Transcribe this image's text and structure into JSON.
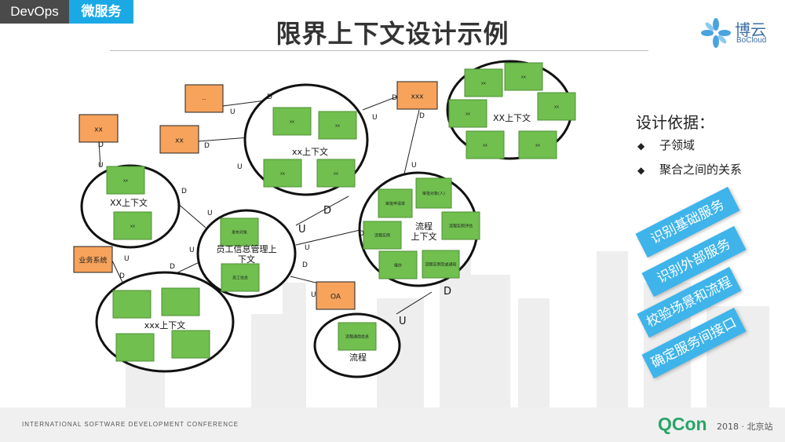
{
  "header": {
    "tag_left": "DevOps",
    "tag_right": "微服务",
    "title": "限界上下文设计示例"
  },
  "logo": {
    "name_cn": "博云",
    "name_en": "BoCloud"
  },
  "design_basis": {
    "title": "设计依据：",
    "items": [
      "子领域",
      "聚合之间的关系"
    ]
  },
  "ribbons": [
    "识别基础服务",
    "识别外部服务",
    "校验场景和流程",
    "确定服务间接口"
  ],
  "footer": {
    "conference": "INTERNATIONAL SOFTWARE DEVELOPMENT CONFERENCE",
    "brand": "QCon",
    "year_city": "2018 · 北京站"
  },
  "diagram": {
    "contexts": [
      {
        "id": "c_xx_top",
        "label": "xx上下文"
      },
      {
        "id": "c_xx_right",
        "label": "XX上下文"
      },
      {
        "id": "c_xx_left",
        "label": "XX上下文"
      },
      {
        "id": "c_employee",
        "label": "员工信息管理上下文"
      },
      {
        "id": "c_flow_ctx",
        "label": "流程上下文"
      },
      {
        "id": "c_xxx",
        "label": "xxx上下文"
      },
      {
        "id": "c_flow",
        "label": "流程"
      }
    ],
    "external_systems": [
      {
        "id": "e_small",
        "label": "··"
      },
      {
        "id": "e_xx1",
        "label": "xx"
      },
      {
        "id": "e_xx2",
        "label": "xx"
      },
      {
        "id": "e_xxx",
        "label": "xxx"
      },
      {
        "id": "e_biz",
        "label": "业务系统"
      },
      {
        "id": "e_oa",
        "label": "OA"
      }
    ],
    "aggregates": [
      {
        "ctx": "c_xx_top",
        "label": "xx"
      },
      {
        "ctx": "c_xx_top",
        "label": "xx"
      },
      {
        "ctx": "c_xx_top",
        "label": "xx"
      },
      {
        "ctx": "c_xx_top",
        "label": "xx"
      },
      {
        "ctx": "c_xx_right",
        "label": "xx"
      },
      {
        "ctx": "c_xx_right",
        "label": "xx"
      },
      {
        "ctx": "c_xx_right",
        "label": "xx"
      },
      {
        "ctx": "c_xx_right",
        "label": "xx"
      },
      {
        "ctx": "c_xx_right",
        "label": "xx"
      },
      {
        "ctx": "c_xx_right",
        "label": "xx"
      },
      {
        "ctx": "c_xx_left",
        "label": "xx"
      },
      {
        "ctx": "c_xx_left",
        "label": "xx"
      },
      {
        "ctx": "c_employee",
        "label": "发布对象"
      },
      {
        "ctx": "c_employee",
        "label": "员工信息"
      },
      {
        "ctx": "c_flow_ctx",
        "label": "审批申请单"
      },
      {
        "ctx": "c_flow_ctx",
        "label": "审批对象(人)"
      },
      {
        "ctx": "c_flow_ctx",
        "label": "流程实例"
      },
      {
        "ctx": "c_flow_ctx",
        "label": "流程实例评估"
      },
      {
        "ctx": "c_flow_ctx",
        "label": "催办"
      },
      {
        "ctx": "c_flow_ctx",
        "label": "流程实例完成通知"
      },
      {
        "ctx": "c_xxx",
        "label": ""
      },
      {
        "ctx": "c_xxx",
        "label": ""
      },
      {
        "ctx": "c_xxx",
        "label": ""
      },
      {
        "ctx": "c_xxx",
        "label": ""
      },
      {
        "ctx": "c_flow",
        "label": "流程通用信息"
      }
    ],
    "relations": [
      {
        "from": "e_small",
        "to": "c_xx_top",
        "d": "D",
        "u": "U"
      },
      {
        "from": "e_xx2",
        "to": "c_xx_top",
        "d": "D",
        "u": "U"
      },
      {
        "from": "e_xxx",
        "to": "c_xx_top",
        "d": "D",
        "u": "U"
      },
      {
        "from": "e_xxx",
        "to": "c_flow_ctx",
        "d": "D",
        "u": "U"
      },
      {
        "from": "e_xx1",
        "to": "c_xx_left",
        "d": "D",
        "u": "U"
      },
      {
        "from": "c_xx_left",
        "to": "c_employee",
        "d": "D",
        "u": "U"
      },
      {
        "from": "c_employee",
        "to": "c_flow_ctx",
        "d": "D",
        "u": "U"
      },
      {
        "from": "c_employee",
        "to": "c_flow_ctx",
        "d": "D",
        "u": "U"
      },
      {
        "from": "e_biz",
        "to": "c_xxx",
        "d": "D",
        "u": "U"
      },
      {
        "from": "c_xxx",
        "to": "c_employee",
        "d": "D",
        "u": "U"
      },
      {
        "from": "c_employee",
        "to": "e_oa",
        "d": "D",
        "u": "U"
      },
      {
        "from": "c_flow_ctx",
        "to": "c_flow",
        "d": "D",
        "u": "U"
      }
    ]
  }
}
